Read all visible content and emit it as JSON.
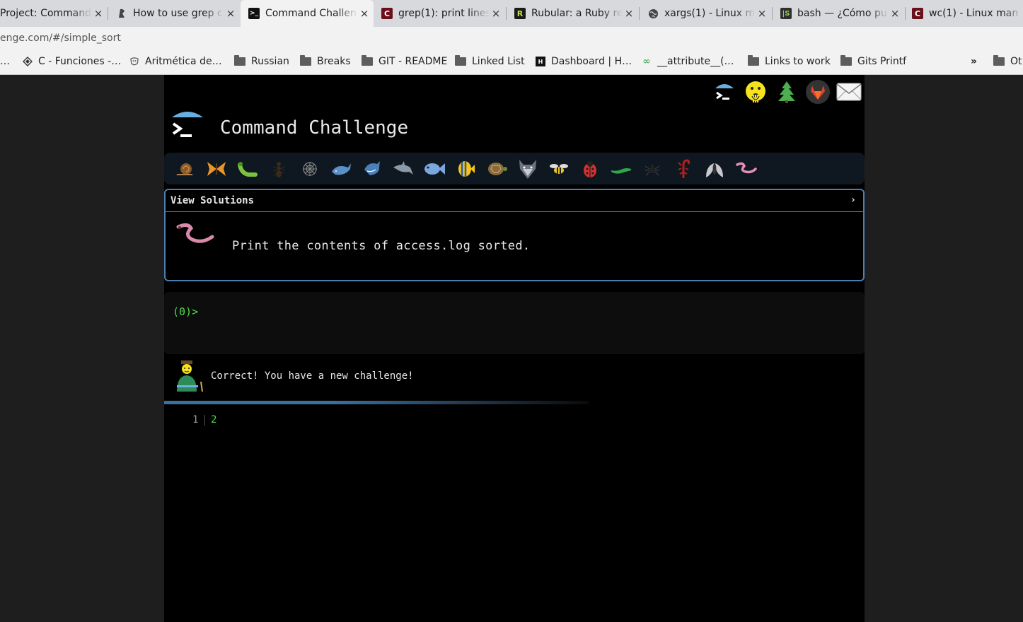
{
  "browser": {
    "tabs": [
      {
        "title": "Project: Command",
        "favicon": "doc-icon"
      },
      {
        "title": "How to use grep c",
        "favicon": "linuxize-icon"
      },
      {
        "title": "Command Challen",
        "favicon": "terminal-icon"
      },
      {
        "title": "grep(1): print lines",
        "favicon": "die-icon"
      },
      {
        "title": "Rubular: a Ruby re",
        "favicon": "rubular-icon"
      },
      {
        "title": "xargs(1) - Linux ma",
        "favicon": "globe-icon"
      },
      {
        "title": "bash — ¿Cómo pu",
        "favicon": "stackexchange-icon"
      },
      {
        "title": "wc(1) - Linux man",
        "favicon": "die-icon"
      }
    ],
    "url": "enge.com/#/simple_sort",
    "bookmarks": [
      {
        "label": "…",
        "icon": "none"
      },
      {
        "label": "C - Funciones -…",
        "icon": "diamond-icon"
      },
      {
        "label": "Aritmética de…",
        "icon": "stamp-icon"
      },
      {
        "label": "Russian",
        "icon": "folder-icon"
      },
      {
        "label": "Breaks",
        "icon": "folder-icon"
      },
      {
        "label": "GIT - README",
        "icon": "folder-icon"
      },
      {
        "label": "Linked List",
        "icon": "folder-icon"
      },
      {
        "label": "Dashboard | H…",
        "icon": "hn-icon"
      },
      {
        "label": "__attribute__(…",
        "icon": "infinity-icon"
      },
      {
        "label": "Links to work",
        "icon": "folder-icon"
      },
      {
        "label": "Gits Printf",
        "icon": "folder-icon"
      }
    ],
    "overflow": "»",
    "other_bookmarks": "Ot"
  },
  "app": {
    "title": "Command Challenge",
    "view_solutions": "View Solutions",
    "chevron": "›",
    "task": "Print the contents of access.log sorted.",
    "prompt": "(0)>",
    "status_message": "Correct! You have a new challenge!",
    "output": {
      "line_no": "1",
      "value": "2"
    },
    "top_icons": [
      "terminal-umbrella-icon",
      "hushed-face-icon",
      "tree-icon",
      "gitlab-icon",
      "mail-icon"
    ],
    "animal_icons": [
      "snail-icon",
      "butterfly-icon",
      "caterpillar-icon",
      "ant-icon",
      "web-icon",
      "whale-icon",
      "shark-icon",
      "dolphin-icon",
      "fish-icon",
      "tropical-fish-icon",
      "turtle-icon",
      "wolf-icon",
      "bee-icon",
      "ladybug-icon",
      "lizard-icon",
      "spider-icon",
      "scorpion-icon",
      "fly-icon",
      "worm-icon"
    ]
  }
}
